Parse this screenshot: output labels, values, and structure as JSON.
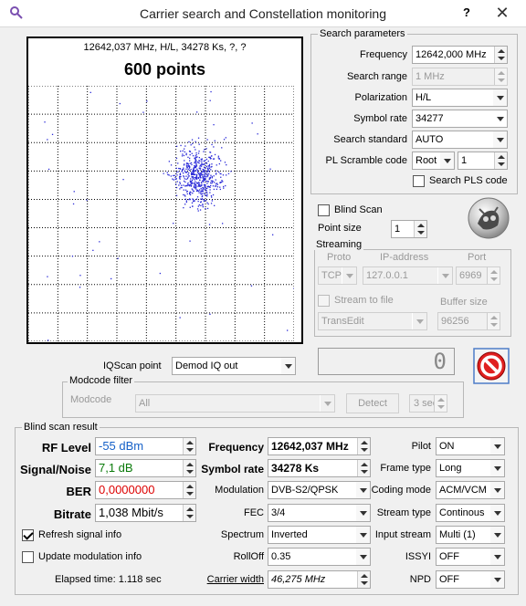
{
  "window": {
    "title": "Carrier search and Constellation monitoring",
    "help": "?",
    "close": "✕"
  },
  "plot": {
    "info": "12642,037 MHz, H/L, 34278 Ks, ?, ?",
    "points": "600 points",
    "dot_color": "#2a2ad8"
  },
  "search": {
    "title": "Search parameters",
    "frequency_label": "Frequency",
    "frequency": "12642,000 MHz",
    "range_label": "Search range",
    "range": "1 MHz",
    "pol_label": "Polarization",
    "pol": "H/L",
    "sr_label": "Symbol rate",
    "sr": "34277",
    "std_label": "Search standard",
    "std": "AUTO",
    "pls_label": "PL Scramble code",
    "pls_mode": "Root",
    "pls_value": "1",
    "pls_search_label": "Search PLS code"
  },
  "blind_scan_label": "Blind Scan",
  "point_size_label": "Point size",
  "point_size": "1",
  "streaming": {
    "title": "Streaming",
    "proto_h": "Proto",
    "ip_h": "IP-address",
    "port_h": "Port",
    "proto": "TCP",
    "ip": "127.0.0.1",
    "port": "6969",
    "stream_file_label": "Stream to file",
    "buffer_label": "Buffer size",
    "dest": "TransEdit",
    "buffer": "96256"
  },
  "counter": "0",
  "iq": {
    "label": "IQScan point",
    "value": "Demod IQ out"
  },
  "modcode": {
    "title": "Modcode filter",
    "label": "Modcode",
    "value": "All",
    "detect": "Detect",
    "sec": "3 sec"
  },
  "result": {
    "title": "Blind scan result",
    "rf_label": "RF Level",
    "rf": "-55 dBm",
    "rf_color": "#1560c8",
    "sn_label": "Signal/Noise",
    "sn": "7,1 dB",
    "sn_color": "#0a7a0a",
    "ber_label": "BER",
    "ber": "0,0000000",
    "ber_color": "#dd0000",
    "br_label": "Bitrate",
    "br": "1,038 Mbit/s",
    "freq_label": "Frequency",
    "freq": "12642,037 MHz",
    "sr_label": "Symbol rate",
    "sr": "34278 Ks",
    "mod_label": "Modulation",
    "mod": "DVB-S2/QPSK",
    "fec_label": "FEC",
    "fec": "3/4",
    "spec_label": "Spectrum",
    "spec": "Inverted",
    "roll_label": "RollOff",
    "roll": "0.35",
    "cw_label": "Carrier width",
    "cw": "46,275 MHz",
    "pilot_label": "Pilot",
    "pilot": "ON",
    "frame_label": "Frame type",
    "frame": "Long",
    "coding_label": "Coding mode",
    "coding": "ACM/VCM",
    "stype_label": "Stream type",
    "stype": "Continous",
    "istream_label": "Input stream",
    "istream": "Multi (1)",
    "issyi_label": "ISSYI",
    "issyi": "OFF",
    "npd_label": "NPD",
    "npd": "OFF",
    "refresh_label": "Refresh signal info",
    "update_label": "Update modulation info",
    "elapsed": "Elapsed time: 1.118 sec"
  }
}
